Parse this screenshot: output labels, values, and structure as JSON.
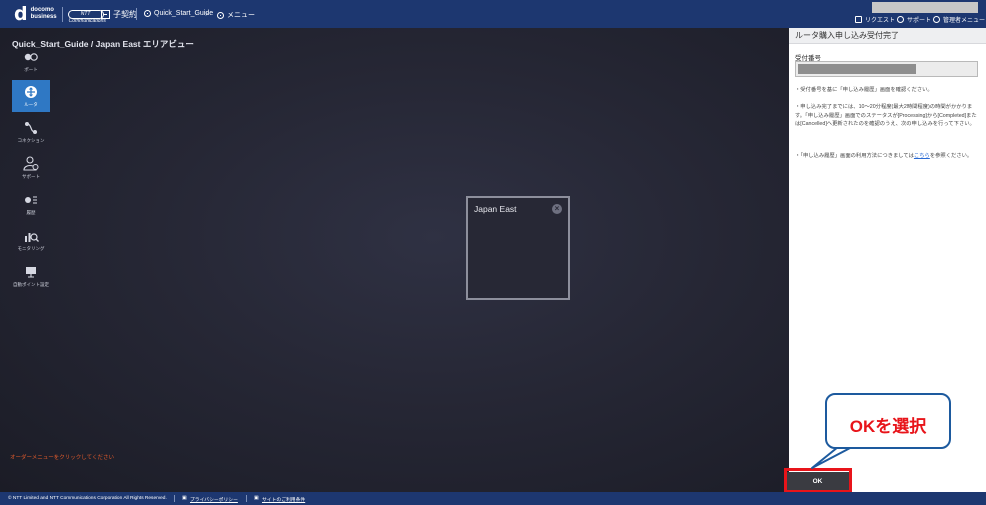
{
  "header": {
    "logo_top": "docomo",
    "logo_bottom": "business",
    "ntt_logo": "NTT Communications",
    "contract_label": "子契約",
    "breadcrumb_project": "Quick_Start_Guide",
    "breadcrumb_menu": "メニュー",
    "links": {
      "request": "リクエスト",
      "support": "サポート",
      "admin_menu": "管理者メニュー"
    }
  },
  "map": {
    "title": "Quick_Start_Guide / Japan East エリアビュー",
    "sidebar": [
      {
        "label": "ポート",
        "icon": "port-icon",
        "active": false
      },
      {
        "label": "ルータ",
        "icon": "router-icon",
        "active": true
      },
      {
        "label": "コネクション",
        "icon": "connection-icon",
        "active": false
      },
      {
        "label": "サポート",
        "icon": "support-icon",
        "active": false
      },
      {
        "label": "履歴",
        "icon": "history-icon",
        "active": false
      },
      {
        "label": "モニタリング",
        "icon": "monitoring-icon",
        "active": false
      },
      {
        "label": "自動ポイント設定",
        "icon": "monitor-screen-icon",
        "active": false
      }
    ],
    "region_card_label": "Japan East",
    "order_hint": "オーダーメニューをクリックしてください"
  },
  "panel": {
    "title": "ルータ購入申し込み受付完了",
    "receipt_label": "受付番号",
    "note1": "・受付番号を基に「申し込み履歴」画面を確認ください。",
    "note2": "・申し込み完了までには、10〜20分程度(最大2時間程度)の時間がかかります。「申し込み履歴」画面でのステータスが[Processing]から[Completed]または[Cancelled]へ更新されたのを確認のうえ、次の申し込みを行って下さい。",
    "note3_before": "・「申し込み履歴」画面の利用方法につきましては",
    "note3_link": "こちら",
    "note3_after": "を参照ください。",
    "ok_label": "OK"
  },
  "callout": {
    "text": "OKを選択"
  },
  "footer": {
    "copyright": "© NTT Limited and NTT Communications Corporation All Rights Reserved.",
    "privacy": "プライバシーポリシー",
    "terms": "サイトのご利用条件"
  },
  "colors": {
    "header_bg": "#1d3770",
    "map_bg": "#262735",
    "active_nav": "#2f78c4",
    "highlight_red": "#e8141a",
    "hint_orange": "#e35b2c"
  }
}
